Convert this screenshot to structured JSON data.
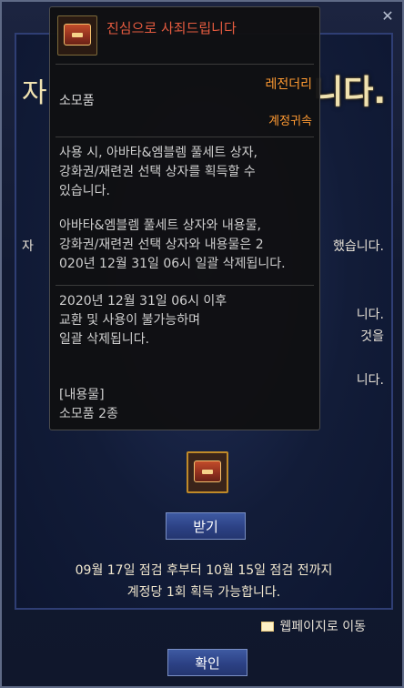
{
  "background": {
    "big_title_fragment": "니다.",
    "right_text_1": "니다.",
    "right_text_2": "니다.",
    "right_text_3": "것을",
    "right_text_4": "니다.",
    "left_fragment_1": "자",
    "left_fragment_2": "자",
    "right_fragment_1": "했습니다."
  },
  "tooltip": {
    "title": "진심으로 사죄드립니다",
    "grade": "레전더리",
    "type": "소모품",
    "bind": "계정귀속",
    "desc1": "사용 시, 아바타&엠블렘 풀세트 상자,\n강화권/재련권 선택 상자를 획득할 수\n있습니다.",
    "desc2": "아바타&엠블렘 풀세트 상자와 내용물,\n강화권/재련권 선택 상자와 내용물은 2\n020년 12월 31일 06시 일괄 삭제됩니다.",
    "desc3": "2020년 12월 31일 06시 이후\n교환 및 사용이 불가능하며\n일괄 삭제됩니다.",
    "contents_header": "[내용물]",
    "contents_item": "소모품 2종"
  },
  "main": {
    "receive_button": "받기",
    "info_line1": "09월 17일 점검 후부터 10월 15일 점검 전까지",
    "info_line2": "계정당 1회 획득 가능합니다.",
    "webpage_link": "웹페이지로 이동",
    "confirm_button": "확인"
  },
  "icons": {
    "close": "close-icon",
    "item": "chest-icon",
    "web": "window-icon"
  }
}
